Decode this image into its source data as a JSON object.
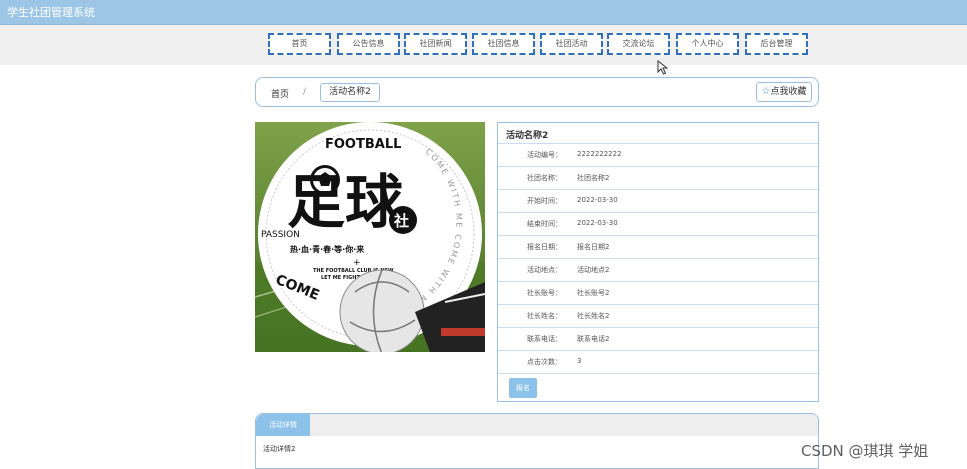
{
  "app": {
    "title": "学生社团管理系统"
  },
  "nav": {
    "items": [
      "首页",
      "公告信息",
      "社团新闻",
      "社团信息",
      "社团活动",
      "交流论坛",
      "个人中心",
      "后台管理"
    ]
  },
  "breadcrumb": {
    "home": "首页",
    "separator": "/",
    "current": "活动名称2"
  },
  "favorite": {
    "icon": "star-icon",
    "label": "点我收藏"
  },
  "poster": {
    "title": "FOOTBALL",
    "main": "足球",
    "badge": "社",
    "passion": "PASSION",
    "slogan": "热·血·青·春·等·你·来",
    "plus": "+",
    "line1": "THE FOOTBALL CLUB IS NEW",
    "line2": "LET ME FIGHT TO",
    "arc": "COME WITH ME COME WITH ME",
    "come": "COME"
  },
  "info": {
    "title": "活动名称2",
    "rows": [
      {
        "label": "活动编号：",
        "value": "2222222222"
      },
      {
        "label": "社团名称：",
        "value": "社团名称2"
      },
      {
        "label": "开始时间：",
        "value": "2022-03-30"
      },
      {
        "label": "结束时间：",
        "value": "2022-03-30"
      },
      {
        "label": "报名日期：",
        "value": "报名日期2"
      },
      {
        "label": "活动地点：",
        "value": "活动地点2"
      },
      {
        "label": "社长账号：",
        "value": "社长账号2"
      },
      {
        "label": "社长姓名：",
        "value": "社长姓名2"
      },
      {
        "label": "联系电话：",
        "value": "联系电话2"
      },
      {
        "label": "点击次数：",
        "value": "3"
      }
    ],
    "signup": "报名"
  },
  "detail": {
    "tab": "活动详情",
    "content": "活动详情2"
  },
  "watermark": "CSDN @琪琪 学姐",
  "colors": {
    "topbar": "#9dc6e6",
    "nav_border": "#2f6fbf",
    "accent": "#8cc2ea",
    "panel_border": "#9bbfe0"
  }
}
